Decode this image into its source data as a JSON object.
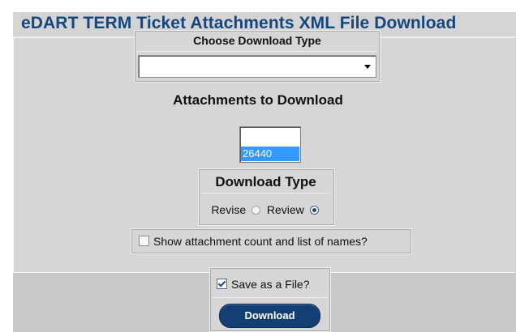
{
  "header": {
    "title": "eDART TERM Ticket Attachments XML File Download"
  },
  "download_type_select": {
    "label": "Choose Download Type",
    "value": ""
  },
  "attachments": {
    "heading": "Attachments to Download",
    "items": [
      "26440"
    ],
    "selected": "26440"
  },
  "download_type": {
    "title": "Download Type",
    "options": [
      {
        "label": "Revise",
        "checked": false
      },
      {
        "label": "Review",
        "checked": true
      }
    ]
  },
  "show_attachments": {
    "label": "Show attachment count and list of names?",
    "checked": false
  },
  "save_as_file": {
    "label": "Save as a File?",
    "checked": true
  },
  "download_button": {
    "label": "Download"
  },
  "colors": {
    "title": "#15477d",
    "button": "#133f74",
    "selected_item": "#3399ff"
  }
}
